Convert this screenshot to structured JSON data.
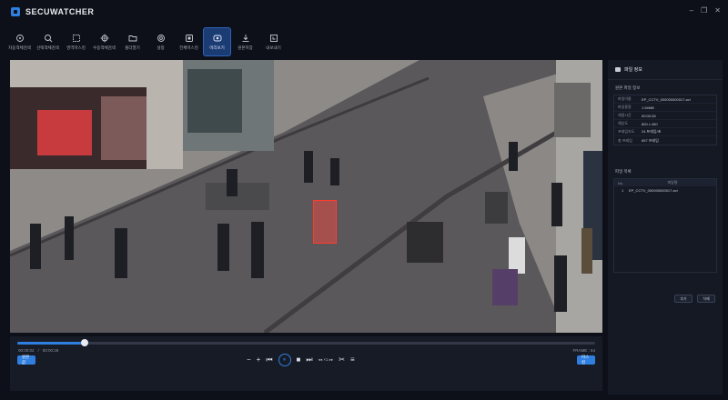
{
  "app": {
    "name": "SECUWATCHER"
  },
  "window_controls": {
    "minimize": "–",
    "restore": "❐",
    "close": "✕"
  },
  "toolbar": {
    "items": [
      {
        "label": "자동객체검색",
        "icon": "crosshair-icon"
      },
      {
        "label": "선택객체검색",
        "icon": "select-search-icon"
      },
      {
        "label": "영역마스킹",
        "icon": "region-mask-icon"
      },
      {
        "label": "수동객체검색",
        "icon": "manual-search-icon"
      },
      {
        "label": "폴더열기",
        "icon": "folder-icon"
      },
      {
        "label": "설정",
        "icon": "gear-icon"
      },
      {
        "label": "전체마스킹",
        "icon": "full-mask-icon"
      },
      {
        "label": "미리보기",
        "icon": "preview-icon",
        "active": true
      },
      {
        "label": "원본저장",
        "icon": "download-icon"
      },
      {
        "label": "내보내기",
        "icon": "export-icon"
      }
    ]
  },
  "player": {
    "current_time": "00:00:02",
    "separator": "/",
    "total_time": "00:00:28",
    "frame_label": "FRAME : 64",
    "progress": 0.117,
    "left_button": "원본값",
    "right_button": "마스킹",
    "buttons": {
      "zoom_out": "−",
      "zoom_in": "+",
      "prev": "⏮",
      "play_pause": "⏸",
      "stop": "■",
      "next": "⏭",
      "speed": "◂◂ ×1 ▸▸",
      "cut": "✂",
      "menu": "≡"
    }
  },
  "panel": {
    "title": "파일 정보",
    "section_original": "원본 파일 정보",
    "info": [
      {
        "key": "파일이름",
        "value": "EP_CCTV_000000000017.avi"
      },
      {
        "key": "파일용량",
        "value": "1.54MB"
      },
      {
        "key": "재생시간",
        "value": "00:00:28"
      },
      {
        "key": "해상도",
        "value": "800 x 450"
      },
      {
        "key": "프레임속도",
        "value": "24 프레임/초"
      },
      {
        "key": "총 프레임",
        "value": "657 프레임"
      }
    ],
    "list_title": "파일 목록",
    "list_headers": {
      "no": "No.",
      "file": "파일명"
    },
    "files": [
      {
        "no": "1",
        "name": "EP_CCTV_000000000017.avi"
      }
    ],
    "add_button": "추가",
    "delete_button": "삭제"
  },
  "colors": {
    "accent": "#2f7fe0",
    "detection": "#ff3b30",
    "background": "#0d1018"
  }
}
